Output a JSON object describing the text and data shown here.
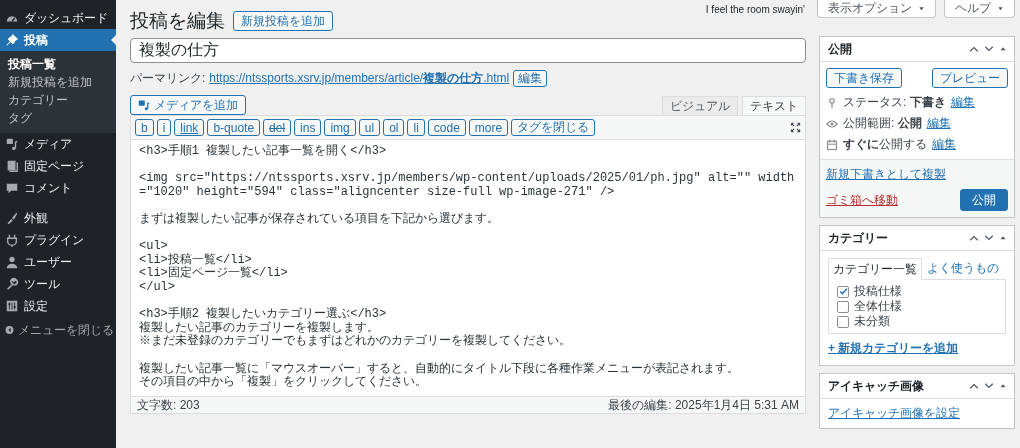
{
  "header": {
    "title": "投稿を編集",
    "add_new": "新規投稿を追加",
    "hello": "I feel the room swayin'",
    "screen_options": "表示オプション",
    "help": "ヘルプ"
  },
  "sidebar": {
    "groups": [
      {
        "items": [
          {
            "label": "ダッシュボード",
            "selected": false
          },
          {
            "label": "投稿",
            "selected": true,
            "children": [
              {
                "label": "投稿一覧",
                "selected": true
              },
              {
                "label": "新規投稿を追加",
                "selected": false
              },
              {
                "label": "カテゴリー",
                "selected": false
              },
              {
                "label": "タグ",
                "selected": false
              }
            ]
          },
          {
            "label": "メディア",
            "selected": false
          },
          {
            "label": "固定ページ",
            "selected": false
          },
          {
            "label": "コメント",
            "selected": false
          }
        ]
      },
      {
        "items": [
          {
            "label": "外観",
            "selected": false
          },
          {
            "label": "プラグイン",
            "selected": false
          },
          {
            "label": "ユーザー",
            "selected": false
          },
          {
            "label": "ツール",
            "selected": false
          },
          {
            "label": "設定",
            "selected": false
          }
        ]
      }
    ],
    "collapse": "メニューを閉じる"
  },
  "editor": {
    "post_title": "複製の仕方",
    "permalink": {
      "label": "パーマリンク:",
      "url": "https://ntssports.xsrv.jp/members/article/**複製の仕方**.html",
      "edit": "編集"
    },
    "add_media": "メディアを追加",
    "tabs": [
      {
        "label": "ビジュアル",
        "selected": false
      },
      {
        "label": "テキスト",
        "selected": true
      }
    ],
    "quicktags": [
      {
        "label": "b",
        "kind": "plain"
      },
      {
        "label": "i",
        "kind": "plain"
      },
      {
        "label": "link",
        "kind": "underline"
      },
      {
        "label": "b-quote",
        "kind": "plain"
      },
      {
        "label": "del",
        "kind": "strike"
      },
      {
        "label": "ins",
        "kind": "plain"
      },
      {
        "label": "img",
        "kind": "plain"
      },
      {
        "label": "ul",
        "kind": "plain"
      },
      {
        "label": "ol",
        "kind": "plain"
      },
      {
        "label": "li",
        "kind": "plain"
      },
      {
        "label": "code",
        "kind": "plain"
      },
      {
        "label": "more",
        "kind": "plain"
      },
      {
        "label": "タグを閉じる",
        "kind": "plain"
      }
    ],
    "content_blocks": [
      [
        "<h3>手順1 複製したい記事一覧を開く</h3>"
      ],
      [
        "<img src=\"https://ntssports.xsrv.jp/members/wp-content/uploads/2025/01/ph.jpg\" alt=\"\" width=\"1020\" height=\"594\" class=\"aligncenter size-full wp-image-271\" />"
      ],
      [
        "まずは複製したい記事が保存されている項目を下記から選びます。"
      ],
      [
        "<ul>",
        "<li>投稿一覧</li>",
        "<li>固定ページ一覧</li>",
        "</ul>"
      ],
      [
        "<h3>手順2 複製したいカテゴリー選ぶ</h3>",
        "複製したい記事のカテゴリーを複製します。",
        "※まだ未登録のカテゴリーでもまずはどれかのカテゴリーを複製してください。"
      ],
      [
        "複製したい記事一覧に「マウスオーバー」すると、自動的にタイトル下段に各種作業メニューが表記されます。",
        "その項目の中から「複製」をクリックしてください。"
      ]
    ],
    "word_count": "文字数: 203",
    "last_edited": "最後の編集: 2025年1月4日 5:31 AM"
  },
  "publish_box": {
    "title": "公開",
    "save_draft": "下書き保存",
    "preview": "プレビュー",
    "rows": [
      {
        "text": "ステータス: **下書き**",
        "link": "編集"
      },
      {
        "text": "公開範囲: **公開**",
        "link": "編集"
      },
      {
        "text": "**すぐに**公開する",
        "link": "編集"
      }
    ],
    "duplicate": "新規下書きとして複製",
    "trash": "ゴミ箱へ移動",
    "publish": "公開"
  },
  "category_box": {
    "title": "カテゴリー",
    "tabs": [
      {
        "label": "カテゴリー一覧",
        "selected": true
      },
      {
        "label": "よく使うもの",
        "selected": false
      }
    ],
    "categories": [
      {
        "label": "投稿仕様",
        "checked": true
      },
      {
        "label": "全体仕様",
        "checked": false
      },
      {
        "label": "未分類",
        "checked": false
      }
    ],
    "add_new": "+ 新規カテゴリーを追加"
  },
  "featured_image_box": {
    "title": "アイキャッチ画像",
    "link": "アイキャッチ画像を設定"
  }
}
